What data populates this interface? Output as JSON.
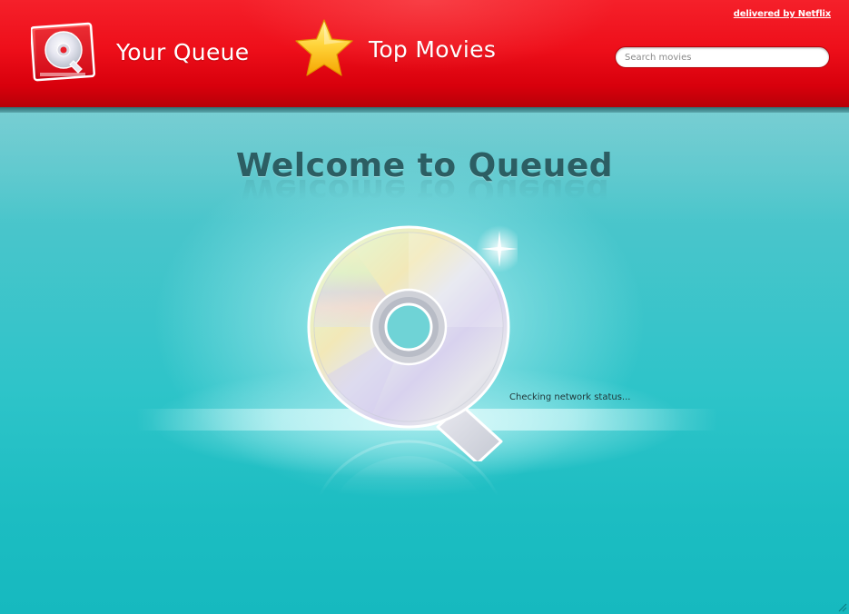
{
  "header": {
    "nav": {
      "queue_label": "Your Queue",
      "queue_icon": "queue-disc-icon",
      "top_label": "Top Movies",
      "top_icon": "star-icon"
    },
    "netflix_link": "delivered by Netflix",
    "search": {
      "placeholder": "Search movies",
      "value": ""
    }
  },
  "main": {
    "title": "Welcome to Queued",
    "logo_icon": "queued-disc-logo",
    "status": "Checking network status..."
  },
  "colors": {
    "header_red": "#ee0f1a",
    "background_teal": "#25c3c8",
    "title_color": "#2c5e63"
  }
}
